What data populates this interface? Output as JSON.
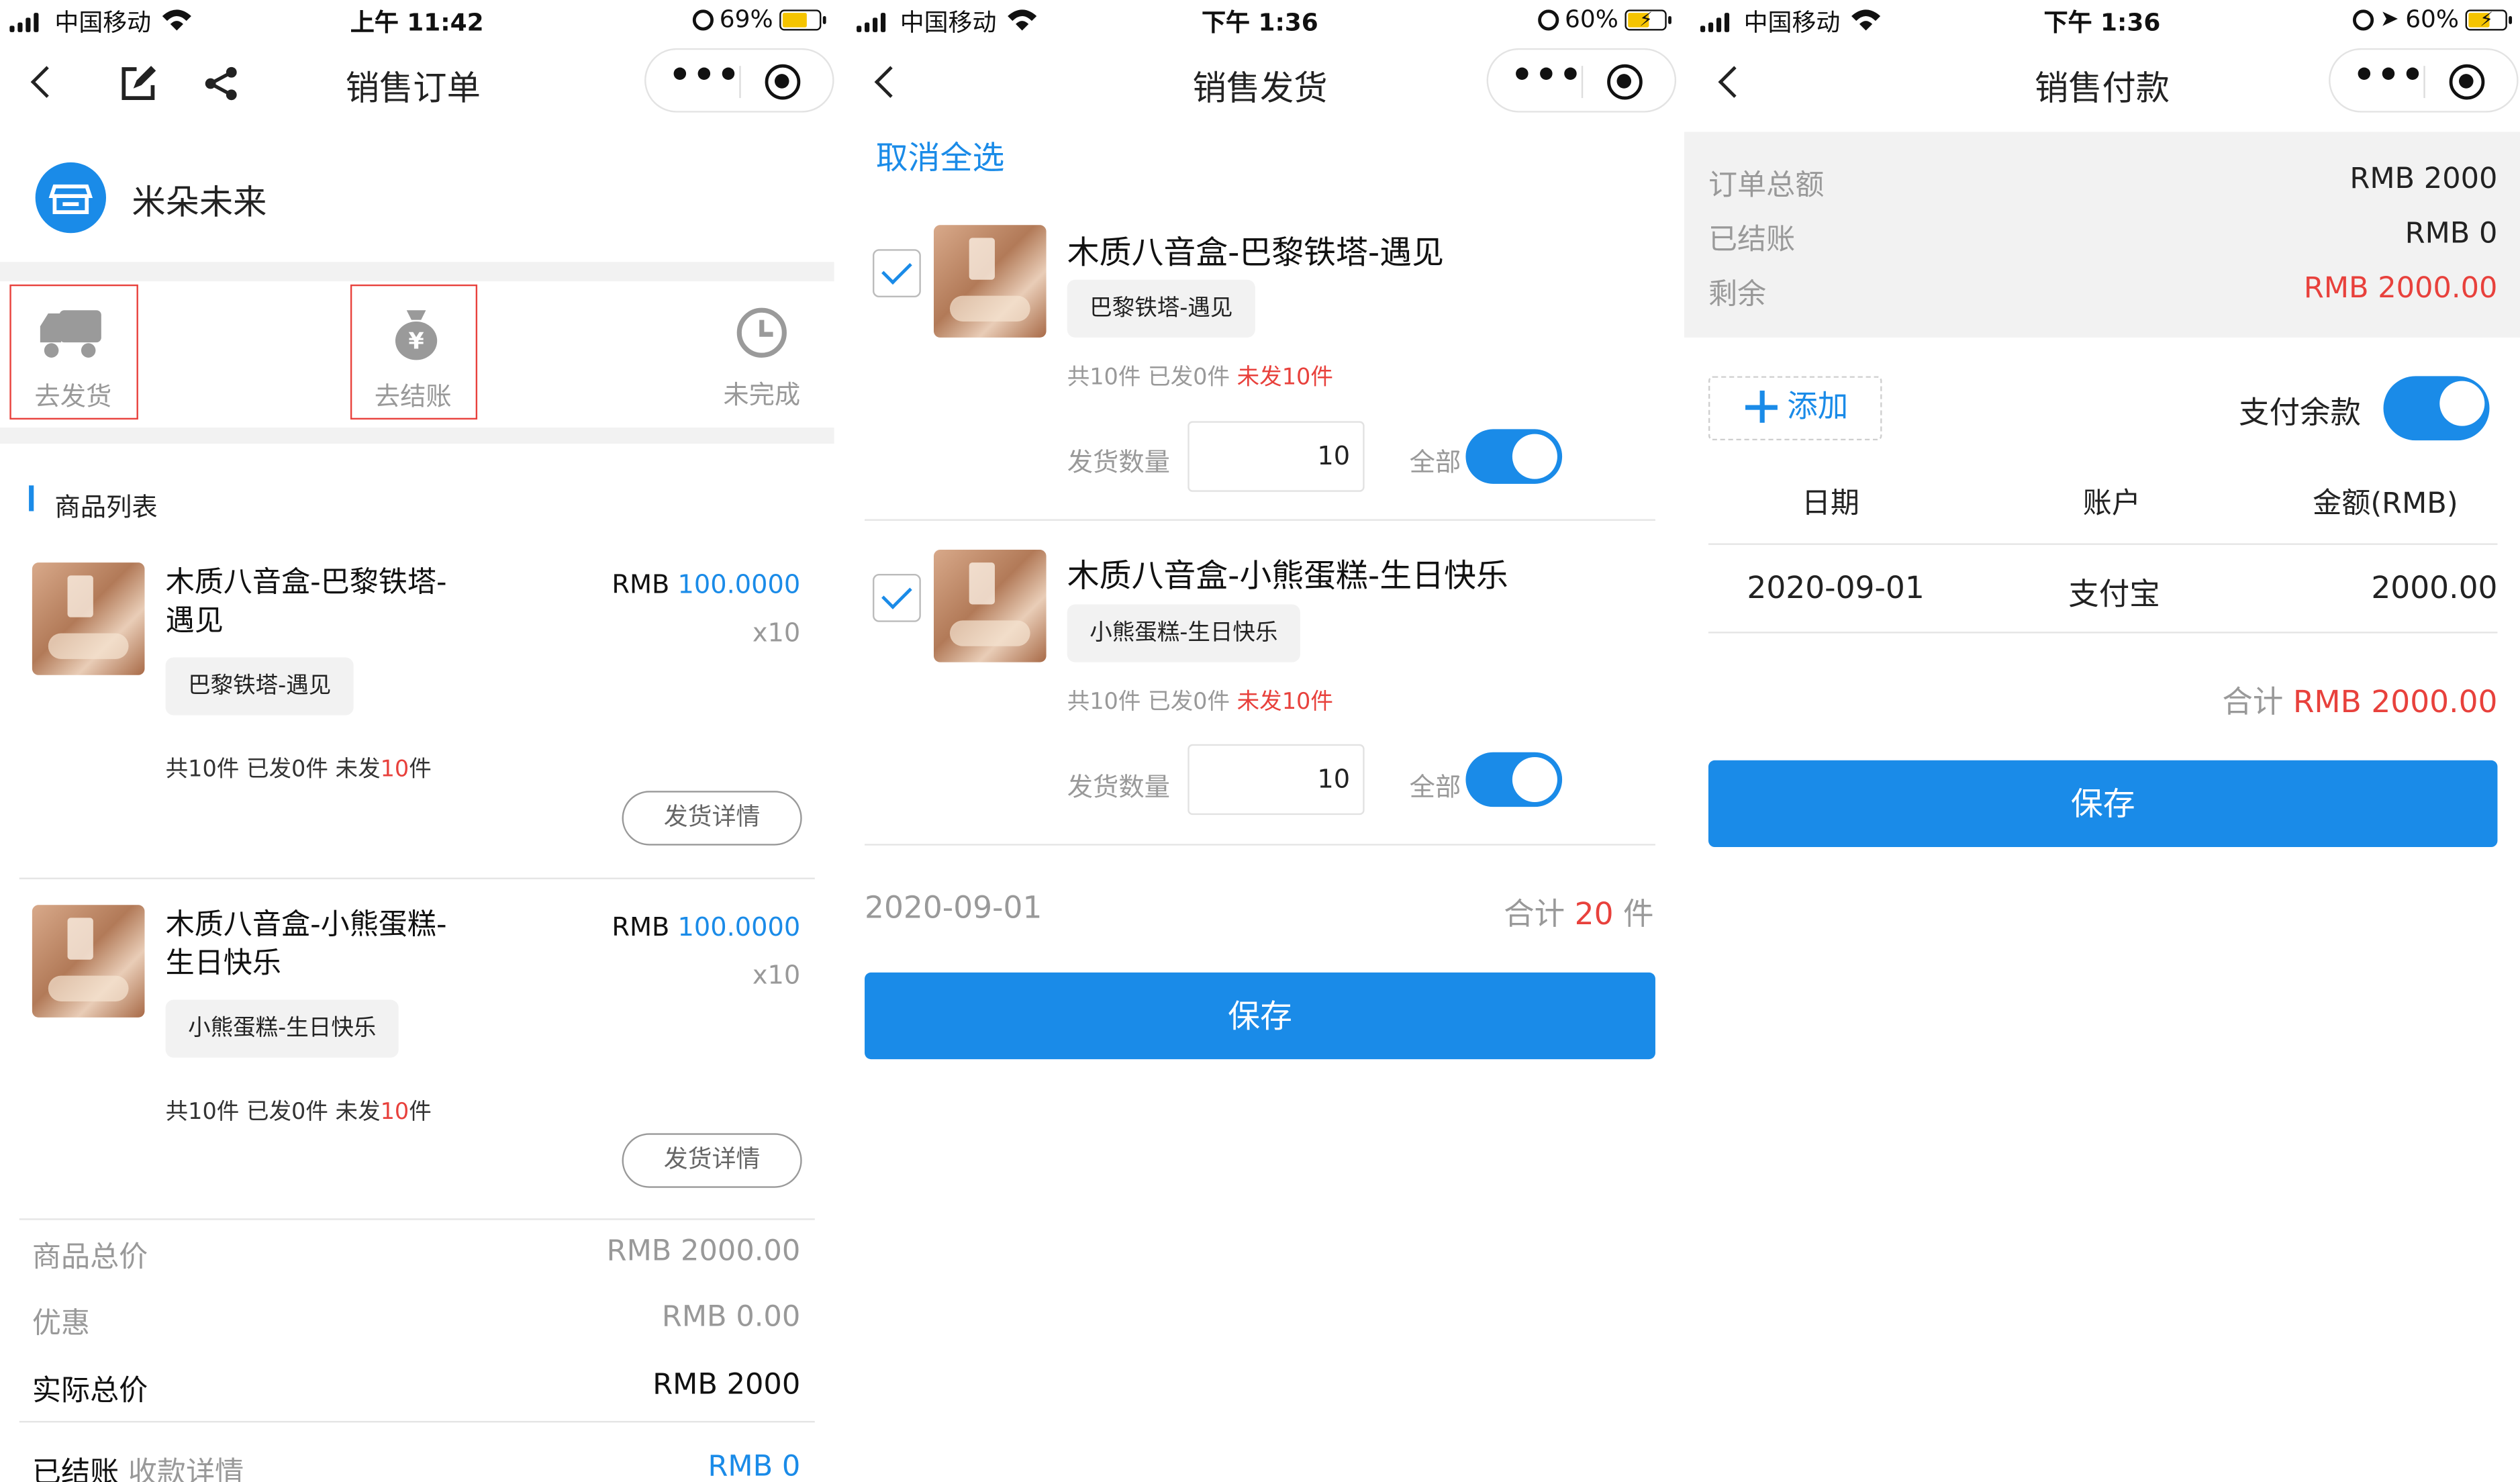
{
  "screen1": {
    "status": {
      "carrier": "中国移动",
      "time": "上午 11:42",
      "battery": "69%"
    },
    "nav_title": "销售订单",
    "store_name": "米朵未来",
    "actions": [
      {
        "label": "去发货",
        "icon": "truck-icon"
      },
      {
        "label": "去结账",
        "icon": "money-bag-icon"
      },
      {
        "label": "未完成",
        "icon": "clock-icon"
      }
    ],
    "section_title": "商品列表",
    "products": [
      {
        "name_line1": "木质八音盒-巴黎铁塔-",
        "name_line2": "遇见",
        "price_prefix": "RMB",
        "price": "100.0000",
        "qty": "x10",
        "tag": "巴黎铁塔-遇见",
        "total": "共10件",
        "shipped": "已发0件",
        "unshipped_prefix": "未发",
        "unshipped_num": "10",
        "unshipped_suffix": "件",
        "detail_btn": "发货详情"
      },
      {
        "name_line1": "木质八音盒-小熊蛋糕-",
        "name_line2": "生日快乐",
        "price_prefix": "RMB",
        "price": "100.0000",
        "qty": "x10",
        "tag": "小熊蛋糕-生日快乐",
        "total": "共10件",
        "shipped": "已发0件",
        "unshipped_prefix": "未发",
        "unshipped_num": "10",
        "unshipped_suffix": "件",
        "detail_btn": "发货详情"
      }
    ],
    "summary": [
      {
        "label": "商品总价",
        "value": "RMB 2000.00"
      },
      {
        "label": "优惠",
        "value": "RMB 0.00"
      },
      {
        "label": "实际总价",
        "value": "RMB 2000"
      }
    ],
    "settled": {
      "label": "已结账",
      "link": "收款详情",
      "value": "RMB 0"
    }
  },
  "screen2": {
    "status": {
      "carrier": "中国移动",
      "time": "下午 1:36",
      "battery": "60%"
    },
    "nav_title": "销售发货",
    "deselect_all": "取消全选",
    "items": [
      {
        "name": "木质八音盒-巴黎铁塔-遇见",
        "tag": "巴黎铁塔-遇见",
        "total": "共10件",
        "shipped": "已发0件",
        "unshipped": "未发10件",
        "qty_label": "发货数量",
        "qty": "10",
        "all_label": "全部"
      },
      {
        "name": "木质八音盒-小熊蛋糕-生日快乐",
        "tag": "小熊蛋糕-生日快乐",
        "total": "共10件",
        "shipped": "已发0件",
        "unshipped": "未发10件",
        "qty_label": "发货数量",
        "qty": "10",
        "all_label": "全部"
      }
    ],
    "date": "2020-09-01",
    "sum_prefix": "合计",
    "sum_num": "20",
    "sum_unit": "件",
    "save": "保存"
  },
  "screen3": {
    "status": {
      "carrier": "中国移动",
      "time": "下午 1:36",
      "battery": "60%"
    },
    "nav_title": "销售付款",
    "summary": [
      {
        "label": "订单总额",
        "value": "RMB 2000"
      },
      {
        "label": "已结账",
        "value": "RMB 0"
      },
      {
        "label": "剩余",
        "value": "RMB 2000.00"
      }
    ],
    "add_label": "添加",
    "pay_balance_label": "支付余款",
    "table_headers": [
      "日期",
      "账户",
      "金额(RMB)"
    ],
    "rows": [
      {
        "date": "2020-09-01",
        "account": "支付宝",
        "amount": "2000.00"
      }
    ],
    "total_prefix": "合计",
    "total_value": "RMB 2000.00",
    "save": "保存"
  },
  "colors": {
    "accent": "#1a8be8",
    "alert": "#e8413c",
    "highlight_box": "#e8413c"
  }
}
